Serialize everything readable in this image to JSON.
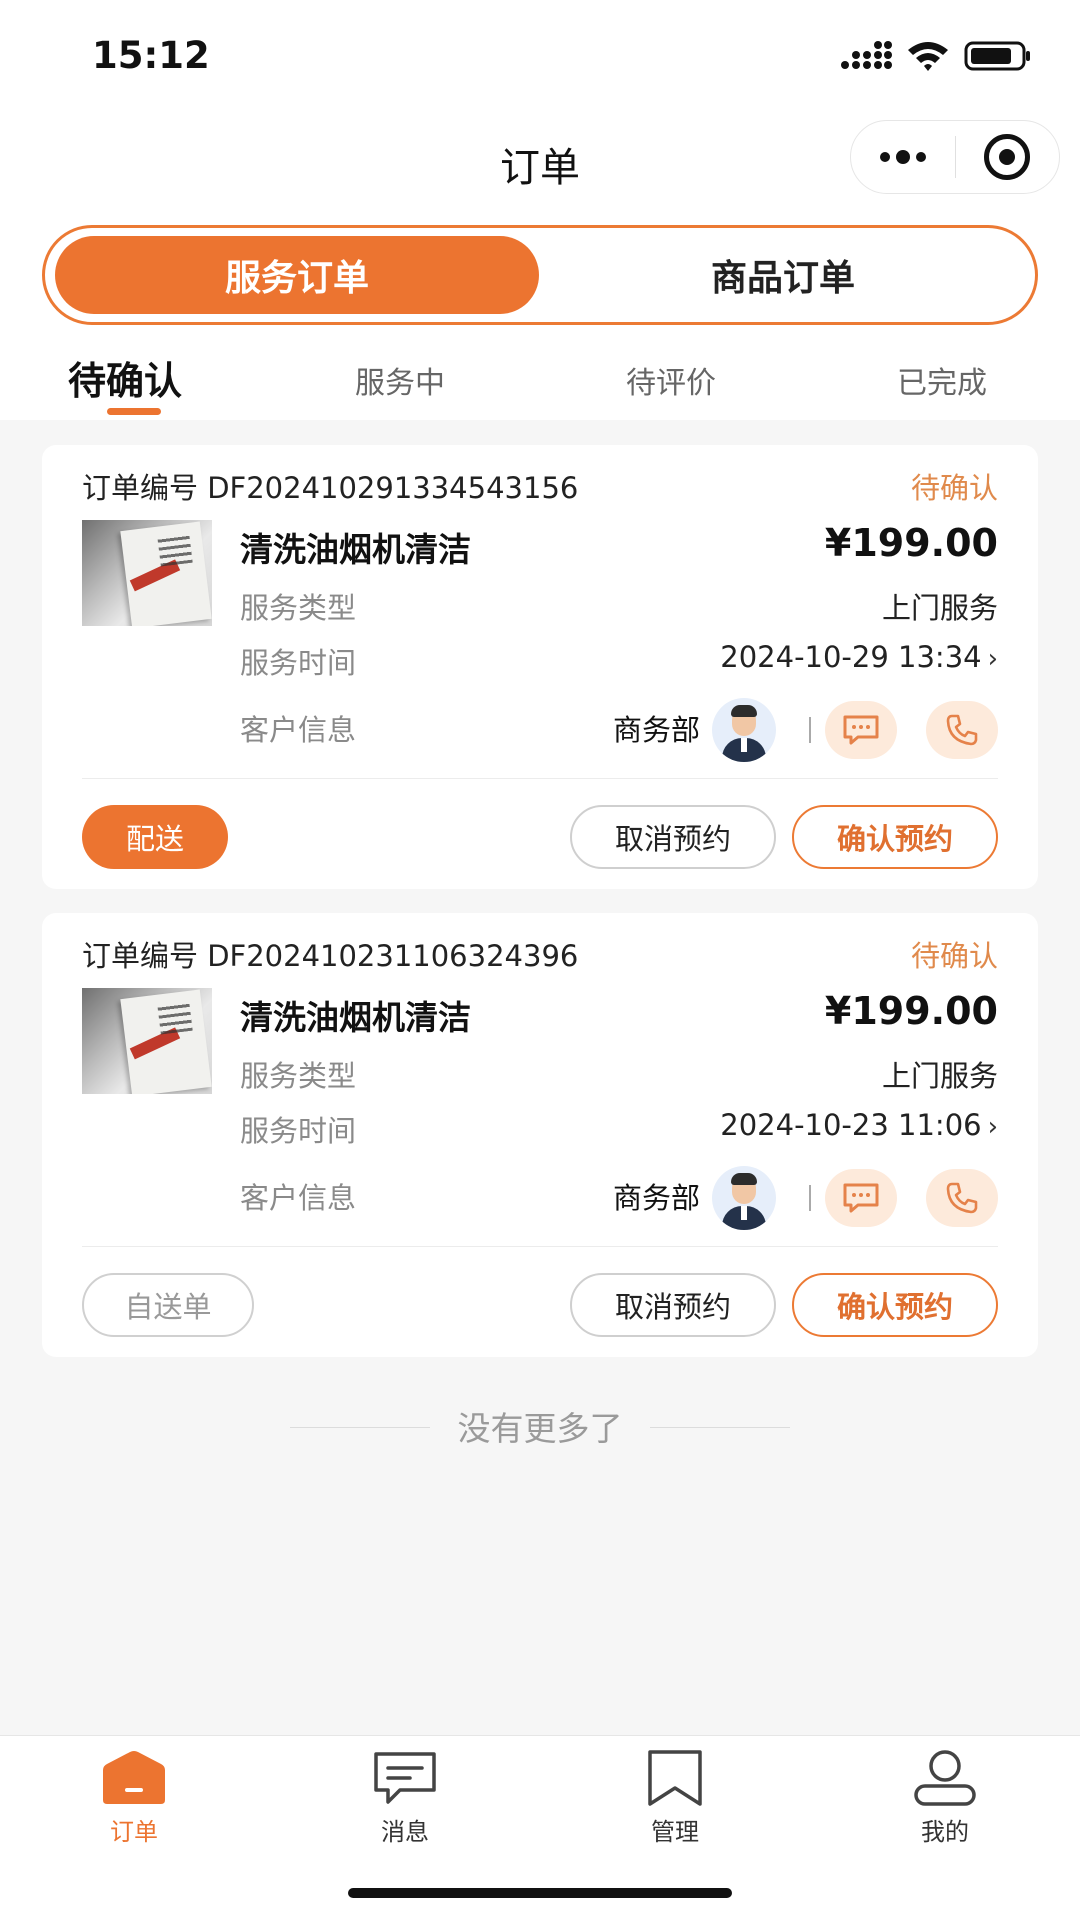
{
  "status_bar": {
    "time": "15:12"
  },
  "nav": {
    "title": "订单"
  },
  "segment": {
    "active": "服务订单",
    "inactive": "商品订单"
  },
  "tabs": [
    "待确认",
    "服务中",
    "待评价",
    "已完成"
  ],
  "orders": [
    {
      "order_no": "订单编号 DF20241029133454315​6",
      "status": "待确认",
      "service_name": "清洗油烟机清洁",
      "price": "¥199.00",
      "type_label": "服务类型",
      "type_value": "上门服务",
      "time_label": "服务时间",
      "time_value": "2024-10-29 13:34",
      "customer_label": "客户信息",
      "customer_name": "商务部",
      "left_button": "配送",
      "cancel_button": "取消预约",
      "confirm_button": "确认预约"
    },
    {
      "order_no": "订单编号 DF20241023110632439​6",
      "status": "待确认",
      "service_name": "清洗油烟机清洁",
      "price": "¥199.00",
      "type_label": "服务类型",
      "type_value": "上门服务",
      "time_label": "服务时间",
      "time_value": "2024-10-23 11:06",
      "customer_label": "客户信息",
      "customer_name": "商务部",
      "left_button": "自送单",
      "cancel_button": "取消预约",
      "confirm_button": "确认预约"
    }
  ],
  "footer_note": "没有更多了",
  "tabbar": [
    {
      "label": "订单",
      "icon": "home-icon",
      "active": true
    },
    {
      "label": "消息",
      "icon": "message-icon",
      "active": false
    },
    {
      "label": "管理",
      "icon": "bookmark-icon",
      "active": false
    },
    {
      "label": "我的",
      "icon": "user-icon",
      "active": false
    }
  ],
  "colors": {
    "accent": "#ec7430",
    "status": "#e08a4c",
    "background": "#f6f6f6"
  }
}
